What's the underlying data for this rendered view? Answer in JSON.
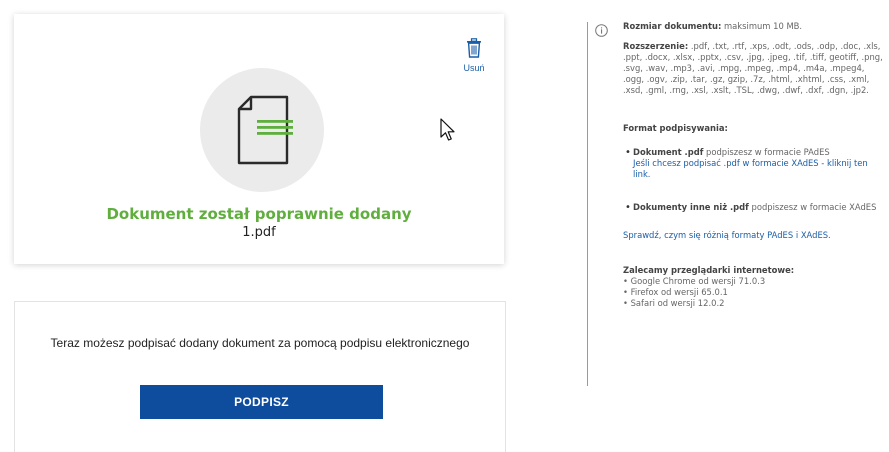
{
  "upload": {
    "delete_label": "Usuń",
    "success_title": "Dokument został poprawnie dodany",
    "file_name": "1.pdf"
  },
  "sign": {
    "text": "Teraz możesz podpisać dodany dokument za pomocą podpisu elektronicznego",
    "button_label": "PODPISZ"
  },
  "info": {
    "size_label": "Rozmiar dokumentu:",
    "size_value": "maksimum 10 MB.",
    "ext_label": "Rozszerzenie:",
    "ext_value": ".pdf, .txt, .rtf, .xps, .odt, .ods, .odp, .doc, .xls, .ppt, .docx, .xlsx, .pptx, .csv, .jpg, .jpeg, .tif, .tiff, geotiff, .png, .svg, .wav, .mp3, .avi, .mpg, .mpeg, .mp4, .m4a, .mpeg4, .ogg, .ogv, .zip, .tar, .gz, gzip, .7z, .html, .xhtml, .css, .xml, .xsd, .gml, .rng, .xsl, .xslt, .TSL, .dwg, .dwf, .dxf, .dgn, .jp2.",
    "format_heading": "Format podpisywania:",
    "format_pdf_bold": "Dokument .pdf",
    "format_pdf_rest": "podpiszesz w formacie PAdES",
    "format_pdf_link": "Jeśli chcesz podpisać .pdf w formacie XAdES - kliknij ten link.",
    "format_other_bold": "Dokumenty inne niż .pdf",
    "format_other_rest": "podpiszesz w formacie XAdES",
    "compare_link": "Sprawdź, czym się różnią formaty PAdES i XAdES.",
    "browsers_heading": "Zalecamy przeglądarki internetowe:",
    "browsers": [
      "Google Chrome od wersji 71.0.3",
      "Firefox od wersji 65.0.1",
      "Safari od wersji 12.0.2"
    ]
  }
}
